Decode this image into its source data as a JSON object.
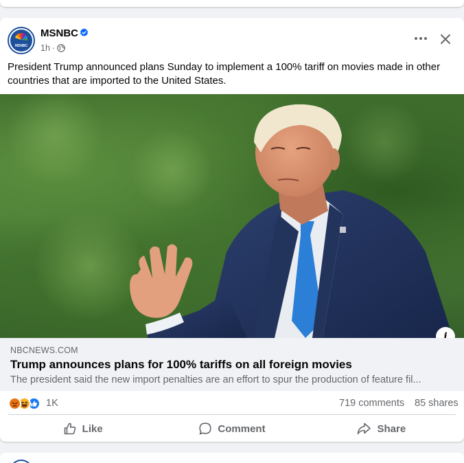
{
  "post": {
    "page_name": "MSNBC",
    "avatar_label": "MSNBC",
    "time": "1h",
    "separator": "·",
    "caption": "President Trump announced plans Sunday to implement a 100% tariff on movies made in other countries that are imported to the United States.",
    "info_glyph": "i",
    "link": {
      "domain": "NBCNEWS.COM",
      "title": "Trump announces plans for 100% tariffs on all foreign movies",
      "description": "The president said the new import penalties are an effort to spur the production of feature fil..."
    },
    "stats": {
      "reaction_icons": [
        "angry-icon",
        "haha-icon",
        "like-icon"
      ],
      "reaction_count": "1K",
      "comments": "719 comments",
      "shares": "85 shares"
    },
    "actions": {
      "like": "Like",
      "comment": "Comment",
      "share": "Share"
    }
  },
  "colors": {
    "brand_blue": "#1d4f9c",
    "verified_blue": "#0866ff",
    "secondary_text": "#65676b",
    "angry_orange": "#e9710f",
    "haha_yellow": "#f7b125",
    "like_blue": "#1877f2"
  }
}
